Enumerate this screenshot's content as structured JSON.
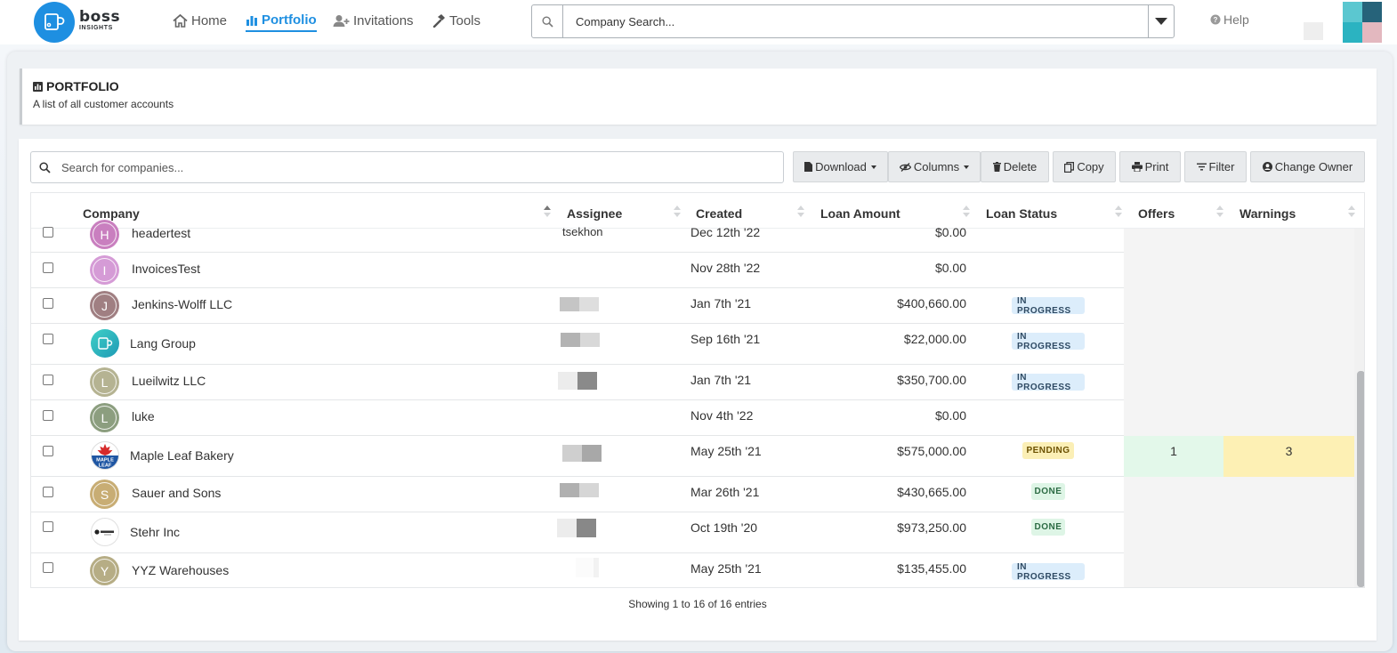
{
  "brand": {
    "name": "boss",
    "tagline": "INSIGHTS",
    "color": "#1e8fe1"
  },
  "nav": {
    "home": "Home",
    "portfolio": "Portfolio",
    "invitations": "Invitations",
    "tools": "Tools",
    "help": "Help"
  },
  "company_search": {
    "placeholder": "Company Search..."
  },
  "page": {
    "title": "PORTFOLIO",
    "subtitle": "A list of all customer accounts"
  },
  "table_search": {
    "placeholder": "Search for companies..."
  },
  "toolbar": {
    "download": "Download",
    "columns": "Columns",
    "delete": "Delete",
    "copy": "Copy",
    "print": "Print",
    "filter": "Filter",
    "change_owner": "Change Owner"
  },
  "columns": {
    "company": "Company",
    "assignee": "Assignee",
    "created": "Created",
    "loan_amount": "Loan Amount",
    "loan_status": "Loan Status",
    "offers": "Offers",
    "warnings": "Warnings"
  },
  "rows": [
    {
      "initial": "H",
      "avatar_color": "#c97fbf",
      "company": "headertest",
      "assignee": "tsekhon",
      "created": "Dec 12th '22",
      "amount": "$0.00",
      "status": "",
      "offers": "",
      "warnings": ""
    },
    {
      "initial": "I",
      "avatar_color": "#d59bd6",
      "company": "InvoicesTest",
      "assignee": "",
      "created": "Nov 28th '22",
      "amount": "$0.00",
      "status": "",
      "offers": "",
      "warnings": ""
    },
    {
      "initial": "J",
      "avatar_color": "#a07f82",
      "company": "Jenkins-Wolff LLC",
      "assignee": "",
      "created": "Jan 7th '21",
      "amount": "$400,660.00",
      "status": "IN PROGRESS",
      "offers": "",
      "warnings": ""
    },
    {
      "initial": "",
      "avatar_color": "#2aaeb6",
      "company": "Lang Group",
      "assignee": "",
      "created": "Sep 16th '21",
      "amount": "$22,000.00",
      "status": "IN PROGRESS",
      "offers": "",
      "warnings": ""
    },
    {
      "initial": "L",
      "avatar_color": "#b5b392",
      "company": "Lueilwitz LLC",
      "assignee": "",
      "created": "Jan 7th '21",
      "amount": "$350,700.00",
      "status": "IN PROGRESS",
      "offers": "",
      "warnings": ""
    },
    {
      "initial": "L",
      "avatar_color": "#8c9e7f",
      "company": "luke",
      "assignee": "",
      "created": "Nov 4th '22",
      "amount": "$0.00",
      "status": "",
      "offers": "",
      "warnings": ""
    },
    {
      "initial": "",
      "avatar_color": "#2a5fa8",
      "company": "Maple Leaf Bakery",
      "assignee": "",
      "created": "May 25th '21",
      "amount": "$575,000.00",
      "status": "PENDING",
      "offers": "1",
      "warnings": "3"
    },
    {
      "initial": "S",
      "avatar_color": "#c8ad74",
      "company": "Sauer and Sons",
      "assignee": "",
      "created": "Mar 26th '21",
      "amount": "$430,665.00",
      "status": "DONE",
      "offers": "",
      "warnings": ""
    },
    {
      "initial": "",
      "avatar_color": "#ffffff",
      "company": "Stehr Inc",
      "assignee": "",
      "created": "Oct 19th '20",
      "amount": "$973,250.00",
      "status": "DONE",
      "offers": "",
      "warnings": ""
    },
    {
      "initial": "Y",
      "avatar_color": "#b6ad85",
      "company": "YYZ Warehouses",
      "assignee": "",
      "created": "May 25th '21",
      "amount": "$135,455.00",
      "status": "IN PROGRESS",
      "offers": "",
      "warnings": ""
    }
  ],
  "footer": {
    "info": "Showing 1 to 16 of 16 entries"
  },
  "colors": {
    "offers_highlight": "#e3f8ea",
    "warnings_highlight": "#fdf0b4",
    "accent": "#1e8fe1"
  }
}
